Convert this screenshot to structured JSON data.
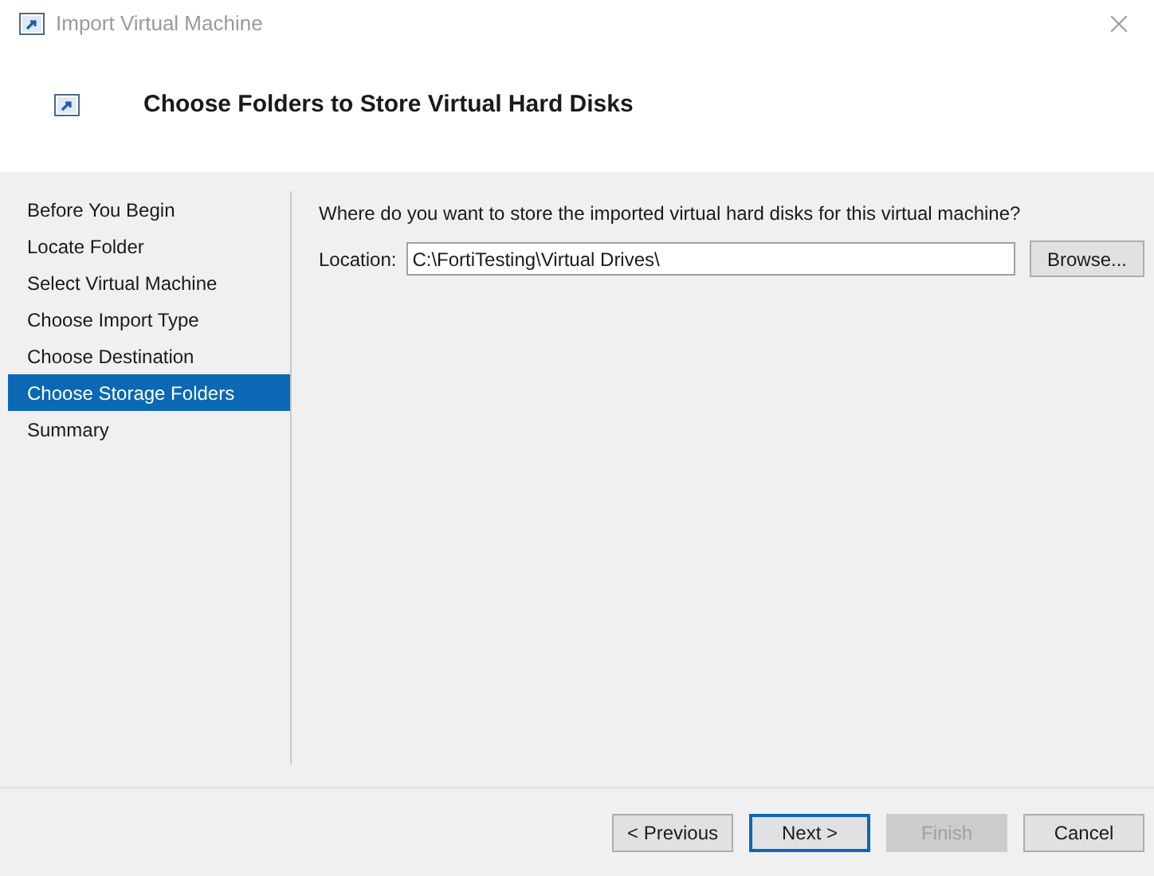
{
  "window": {
    "title": "Import Virtual Machine"
  },
  "header": {
    "title": "Choose Folders to Store Virtual Hard Disks"
  },
  "steps": [
    {
      "label": "Before You Begin",
      "selected": false
    },
    {
      "label": "Locate Folder",
      "selected": false
    },
    {
      "label": "Select Virtual Machine",
      "selected": false
    },
    {
      "label": "Choose Import Type",
      "selected": false
    },
    {
      "label": "Choose Destination",
      "selected": false
    },
    {
      "label": "Choose Storage Folders",
      "selected": true
    },
    {
      "label": "Summary",
      "selected": false
    }
  ],
  "content": {
    "question": "Where do you want to store the imported virtual hard disks for this virtual machine?",
    "location_label": "Location:",
    "location_value": "C:\\FortiTesting\\Virtual Drives\\",
    "browse": "Browse..."
  },
  "buttons": [
    {
      "label": "< Previous",
      "disabled": false,
      "focused": false
    },
    {
      "label": "Next >",
      "disabled": false,
      "focused": true
    },
    {
      "label": "Finish",
      "disabled": true,
      "focused": false
    },
    {
      "label": "Cancel",
      "disabled": false,
      "focused": false
    }
  ]
}
